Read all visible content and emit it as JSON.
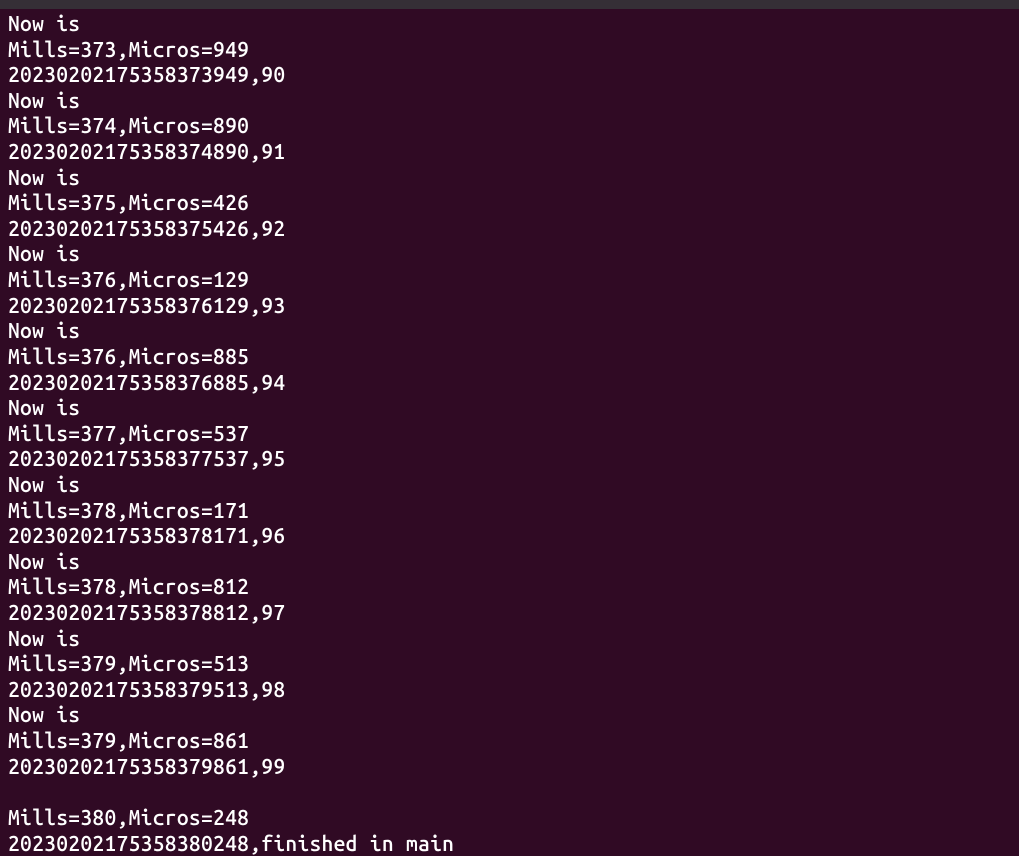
{
  "terminal": {
    "entries": [
      {
        "header": "Now is",
        "mills": "373",
        "micros": "949",
        "timestamp": "20230202175358373949",
        "counter": "90"
      },
      {
        "header": "Now is",
        "mills": "374",
        "micros": "890",
        "timestamp": "20230202175358374890",
        "counter": "91"
      },
      {
        "header": "Now is",
        "mills": "375",
        "micros": "426",
        "timestamp": "20230202175358375426",
        "counter": "92"
      },
      {
        "header": "Now is",
        "mills": "376",
        "micros": "129",
        "timestamp": "20230202175358376129",
        "counter": "93"
      },
      {
        "header": "Now is",
        "mills": "376",
        "micros": "885",
        "timestamp": "20230202175358376885",
        "counter": "94"
      },
      {
        "header": "Now is",
        "mills": "377",
        "micros": "537",
        "timestamp": "20230202175358377537",
        "counter": "95"
      },
      {
        "header": "Now is",
        "mills": "378",
        "micros": "171",
        "timestamp": "20230202175358378171",
        "counter": "96"
      },
      {
        "header": "Now is",
        "mills": "378",
        "micros": "812",
        "timestamp": "20230202175358378812",
        "counter": "97"
      },
      {
        "header": "Now is",
        "mills": "379",
        "micros": "513",
        "timestamp": "20230202175358379513",
        "counter": "98"
      },
      {
        "header": "Now is",
        "mills": "379",
        "micros": "861",
        "timestamp": "20230202175358379861",
        "counter": "99"
      }
    ],
    "final": {
      "mills": "380",
      "micros": "248",
      "timestamp": "20230202175358380248",
      "message": "finished in main"
    },
    "labels": {
      "mills_prefix": "Mills=",
      "micros_prefix": ",Micros=",
      "sep": ","
    }
  }
}
